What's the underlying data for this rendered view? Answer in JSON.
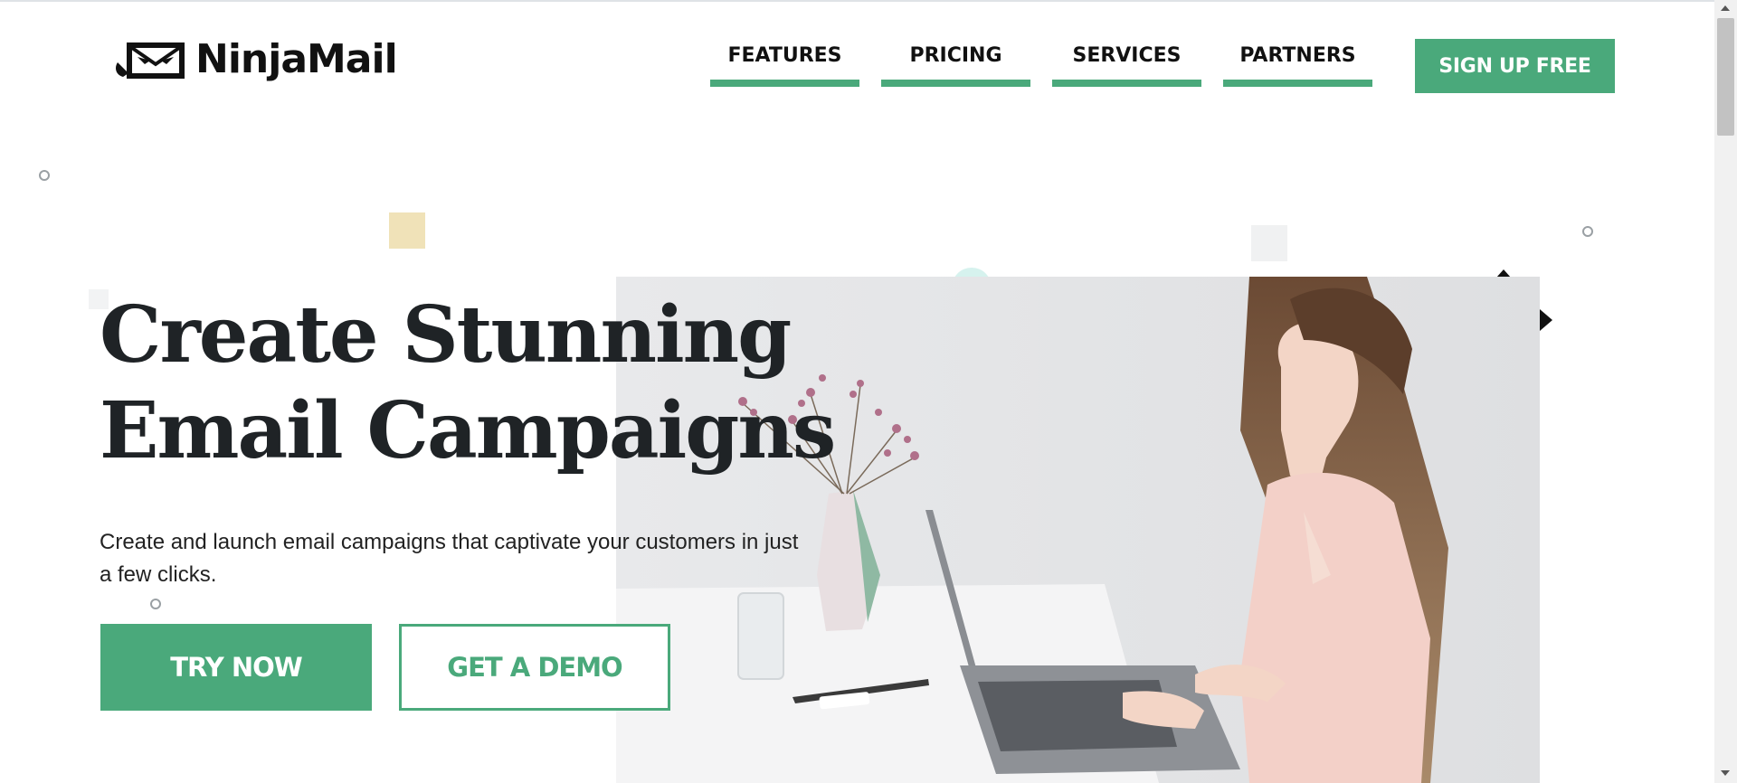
{
  "brand": {
    "name": "NinjaMail",
    "logo_icon": "ninja-envelope-icon",
    "accent_color": "#4aa97b"
  },
  "nav": {
    "items": [
      {
        "label": "FEATURES"
      },
      {
        "label": "PRICING"
      },
      {
        "label": "SERVICES"
      },
      {
        "label": "PARTNERS"
      }
    ],
    "cta_label": "SIGN UP FREE"
  },
  "hero": {
    "headline_line1": "Create Stunning",
    "headline_line2": "Email Campaigns",
    "subtext": "Create and launch email campaigns that captivate your customers in just a few clicks.",
    "primary_button": "TRY NOW",
    "secondary_button": "GET A DEMO",
    "image_subject": "woman-typing-on-laptop-photo"
  }
}
